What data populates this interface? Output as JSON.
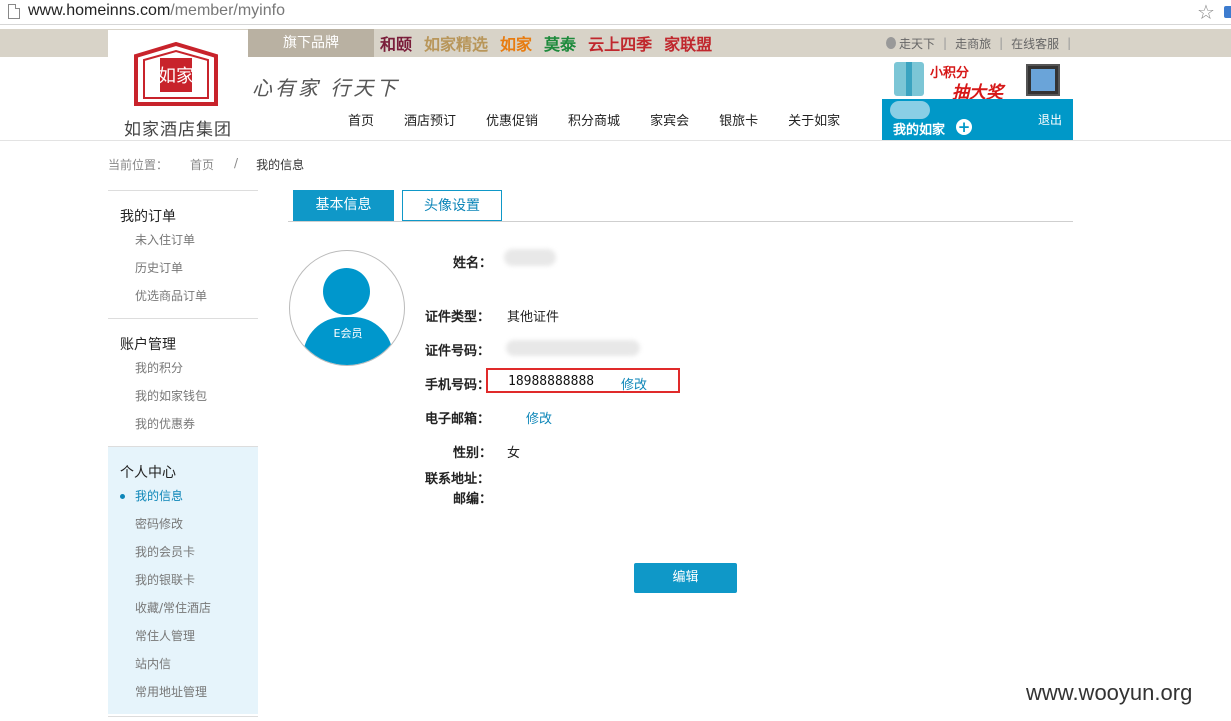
{
  "browser": {
    "url_host": "www.homeinns.com",
    "url_path": "/member/myinfo"
  },
  "brand_bar": {
    "flag_label": "旗下品牌",
    "brands": [
      {
        "name": "和颐",
        "color": "#7a1d3a"
      },
      {
        "name": "如家精选",
        "color": "#b8965a"
      },
      {
        "name": "如家",
        "color": "#e87c10"
      },
      {
        "name": "莫泰",
        "color": "#1e8a3c"
      },
      {
        "name": "云上四季",
        "color": "#c0272d"
      },
      {
        "name": "家联盟",
        "color": "#c0272d"
      }
    ],
    "links": [
      "走天下",
      "走商旅",
      "在线客服"
    ]
  },
  "header": {
    "logo_text": "如家酒店集团",
    "slogan": "心有家 行天下",
    "nav": [
      "首页",
      "酒店预订",
      "优惠促销",
      "积分商城",
      "家宾会",
      "银旅卡",
      "关于如家"
    ],
    "promo_line1": "小积分",
    "promo_line2": "抽大奖",
    "my_homeinns": "我的如家",
    "logout": "退出"
  },
  "breadcrumb": {
    "prefix": "当前位置：",
    "home": "首页",
    "sep": "/",
    "current": "我的信息"
  },
  "sidebar": {
    "groups": [
      {
        "title": "我的订单",
        "items": [
          "未入住订单",
          "历史订单",
          "优选商品订单"
        ]
      },
      {
        "title": "账户管理",
        "items": [
          "我的积分",
          "我的如家钱包",
          "我的优惠券"
        ]
      },
      {
        "title": "个人中心",
        "items": [
          "我的信息",
          "密码修改",
          "我的会员卡",
          "我的银联卡",
          "收藏/常住酒店",
          "常住人管理",
          "站内信",
          "常用地址管理"
        ]
      }
    ]
  },
  "tabs": [
    "基本信息",
    "头像设置"
  ],
  "avatar": {
    "label": "E会员"
  },
  "info": {
    "name_label": "姓名：",
    "idtype_label": "证件类型：",
    "idtype_value": "其他证件",
    "idno_label": "证件号码：",
    "phone_label": "手机号码：",
    "phone_value": "18988888888",
    "modify": "修改",
    "email_label": "电子邮箱：",
    "gender_label": "性别：",
    "gender_value": "女",
    "address_label": "联系地址：",
    "zip_label": "邮编："
  },
  "edit_button": "编辑",
  "watermark": "www.wooyun.org",
  "colors": {
    "accent": "#0f98c8",
    "highlight_box": "#e02a2a"
  }
}
